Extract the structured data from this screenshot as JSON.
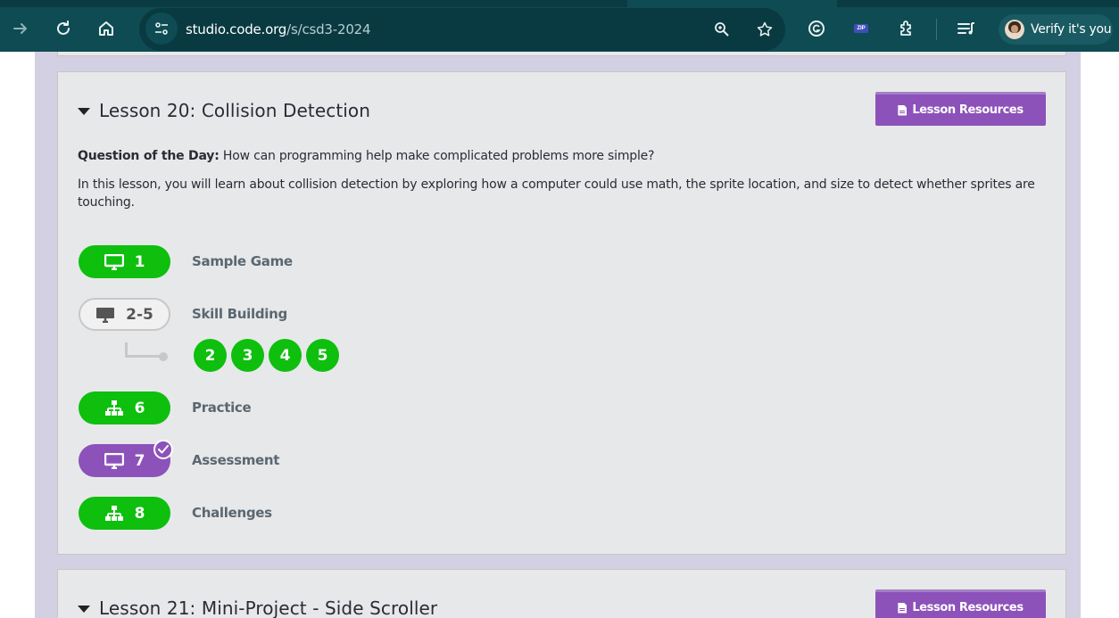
{
  "browser": {
    "url_host": "studio.code.org",
    "url_path": "/s/csd3-2024",
    "verify_label": "Verify it's you",
    "icons": [
      "forward-icon",
      "reload-icon",
      "home-icon",
      "site-settings-icon",
      "zoom-icon",
      "bookmark-star-icon",
      "grammarly-icon",
      "zip-extension-icon",
      "extensions-icon",
      "reading-list-icon",
      "profile-avatar"
    ],
    "zip_badge": "ZIP"
  },
  "lessons": [
    {
      "title": "Lesson 20: Collision Detection",
      "resources_label": "Lesson Resources",
      "qotd_label": "Question of the Day:",
      "qotd_text": " How can programming help make complicated problems more simple?",
      "description": "In this lesson, you will learn about collision detection by exploring how a computer could use math, the sprite location, and size to detect whether sprites are touching.",
      "levels": [
        {
          "number": "1",
          "label": "Sample Game",
          "icon": "computer-icon",
          "status": "complete"
        },
        {
          "number": "2-5",
          "label": "Skill Building",
          "icon": "computer-icon",
          "status": "not-started",
          "sublevels": [
            "2",
            "3",
            "4",
            "5"
          ]
        },
        {
          "number": "6",
          "label": "Practice",
          "icon": "hierarchy-icon",
          "status": "complete"
        },
        {
          "number": "7",
          "label": "Assessment",
          "icon": "computer-icon",
          "status": "submitted"
        },
        {
          "number": "8",
          "label": "Challenges",
          "icon": "hierarchy-icon",
          "status": "complete"
        }
      ]
    },
    {
      "title": "Lesson 21: Mini-Project - Side Scroller",
      "resources_label": "Lesson Resources"
    }
  ],
  "colors": {
    "toolbar": "#0e4b53",
    "complete_green": "#0ebf0e",
    "purple": "#8c52ba",
    "page_bg": "#d4d0e3",
    "card_bg": "#e7e8ea"
  }
}
